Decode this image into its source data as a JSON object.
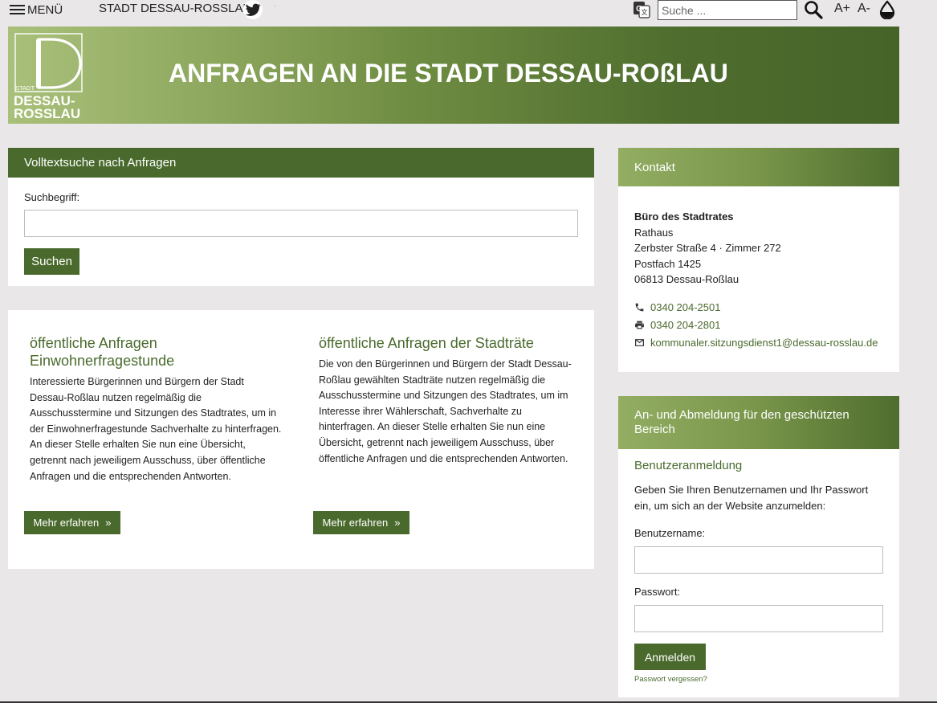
{
  "topbar": {
    "menu_label": "MENÜ",
    "site_title": "STADT DESSAU-ROSSLAU",
    "search_placeholder": "Suche ...",
    "font_increase": "A+",
    "font_decrease": "A-"
  },
  "header": {
    "logo_small": "STADT",
    "logo_line1": "DESSAU-",
    "logo_line2": "ROSSLAU",
    "logo_letter": "D",
    "title": "ANFRAGEN AN DIE STADT DESSAU-ROßLAU"
  },
  "search_panel": {
    "heading": "Volltextsuche nach Anfragen",
    "field_label": "Suchbegriff:",
    "field_value": "",
    "button_label": "Suchen"
  },
  "anfragen": [
    {
      "title": "öffentliche Anfragen Einwohnerfragestunde",
      "text": "Interessierte Bürgerinnen und Bürgern der Stadt Dessau-Roßlau nutzen regelmäßig die Ausschusstermine und Sitzungen des Stadtrates, um in der Einwohnerfragestunde Sachverhalte zu hinterfragen. An dieser Stelle erhalten Sie nun eine Übersicht, getrennt nach jeweiligem Ausschuss, über öffentliche Anfragen und die entsprechenden Antworten.",
      "button_label": "Mehr erfahren"
    },
    {
      "title": "öffentliche Anfragen der Stadträte",
      "text": "Die von den Bürgerinnen und Bürgern der Stadt Dessau-Roßlau gewählten Stadträte nutzen regelmäßig die Ausschusstermine und Sitzungen des Stadtrates, um im Interesse ihrer Wählerschaft, Sachverhalte zu hinterfragen. An dieser Stelle erhalten Sie nun eine Übersicht, getrennt nach jeweiligem Ausschuss, über öffentliche Anfragen und die entsprechenden Antworten.",
      "button_label": "Mehr erfahren"
    }
  ],
  "contact": {
    "heading": "Kontakt",
    "organization": "Büro des Stadtrates",
    "building": "Rathaus",
    "street": "Zerbster Straße 4 · Zimmer 272",
    "po_box": "Postfach 1425",
    "city": "06813 Dessau-Roßlau",
    "phone": "0340 204-2501",
    "fax": "0340 204-2801",
    "email": "kommunaler.sitzungsdienst1@dessau-rosslau.de"
  },
  "login": {
    "heading": "An- und Abmeldung für den geschützten Bereich",
    "subheading": "Benutzeranmeldung",
    "intro": "Geben Sie Ihren Benutzernamen und Ihr Passwort ein, um sich an der Website anzumelden:",
    "username_label": "Benutzername:",
    "username_value": "",
    "password_label": "Passwort:",
    "password_value": "",
    "button_label": "Anmelden",
    "forgot_label": "Passwort vergessen?"
  },
  "colors": {
    "brand_green": "#4a6a2d",
    "page_bg": "#e9e7e7"
  }
}
